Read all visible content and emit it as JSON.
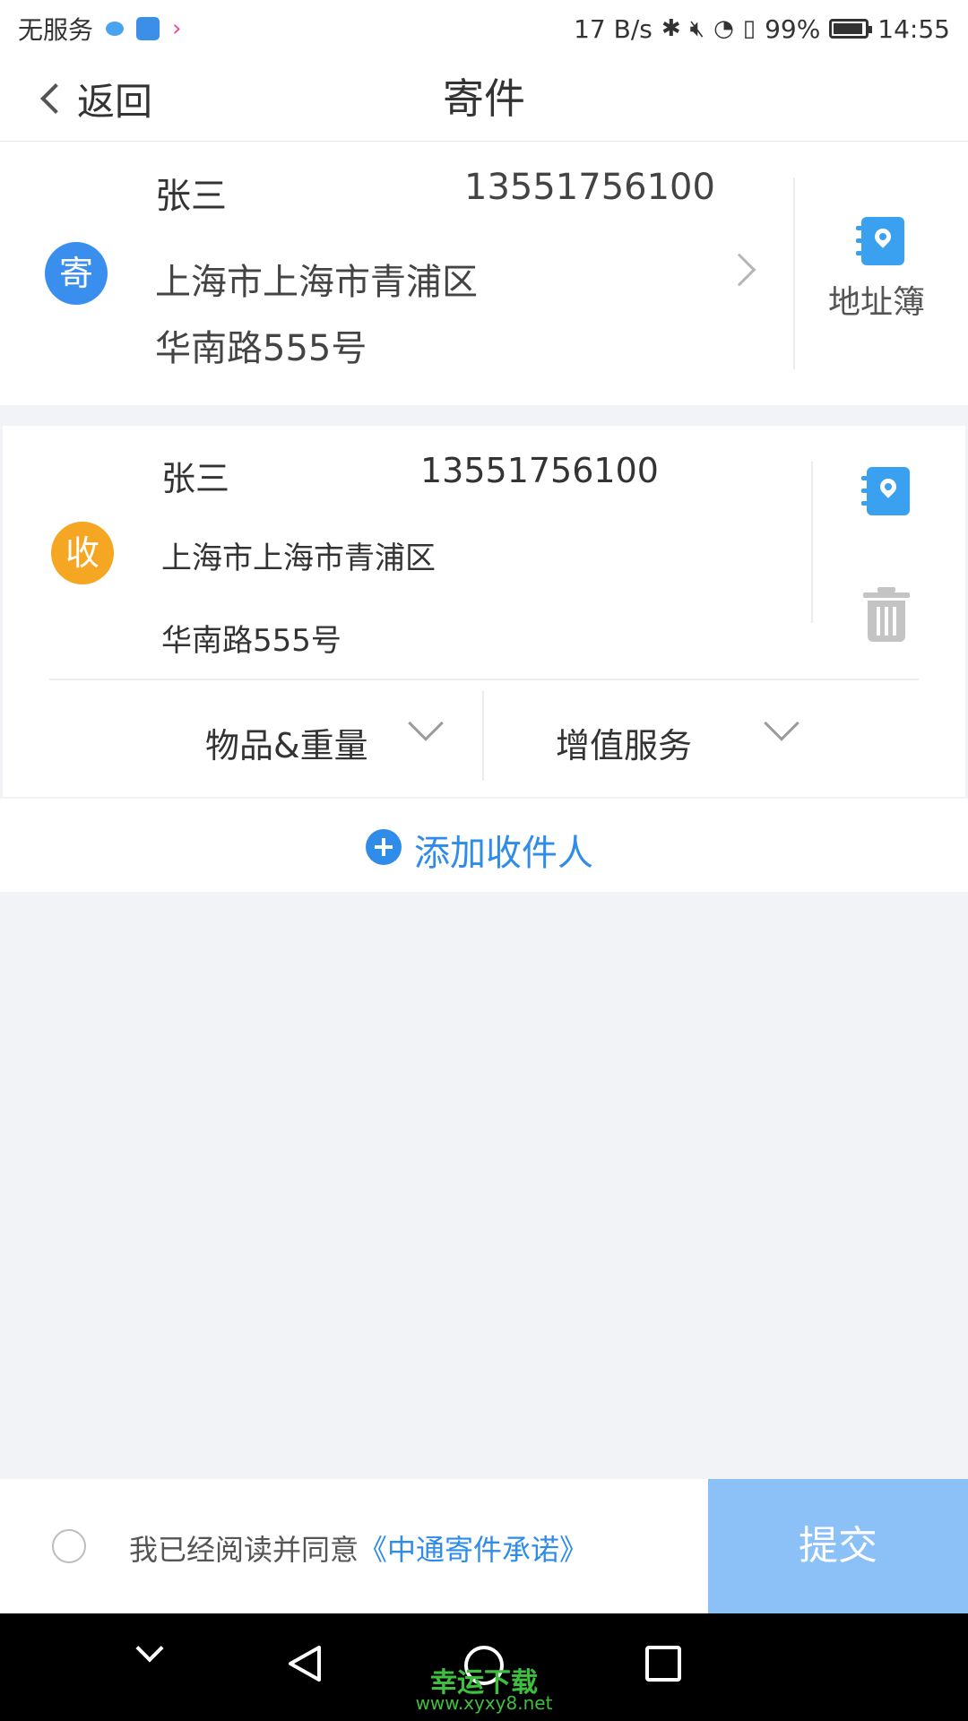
{
  "status_bar": {
    "carrier": "无服务",
    "net_speed": "17 B/s",
    "battery": "99%",
    "time": "14:55",
    "app_icon_color_1": "#49a3f0",
    "app_icon_color_2": "#3c8fe6",
    "app_icon_color_3": "#e64aa0"
  },
  "header": {
    "back_label": "返回",
    "title": "寄件"
  },
  "sender": {
    "badge": "寄",
    "badge_color": "#3a8fee",
    "name": "张三",
    "phone": "13551756100",
    "address_line1": "上海市上海市青浦区",
    "address_line2": "华南路555号",
    "address_book_label": "地址簿"
  },
  "receiver": {
    "badge": "收",
    "badge_color": "#f5a623",
    "name": "张三",
    "phone": "13551756100",
    "address_line1": "上海市上海市青浦区",
    "address_line2": "华南路555号",
    "goods_weight_label": "物品&重量",
    "value_added_label": "增值服务"
  },
  "add_receiver_label": "添加收件人",
  "agreement": {
    "prefix": "我已经阅读并同意",
    "link": "《中通寄件承诺》",
    "checked": false
  },
  "submit_label": "提交",
  "watermark": {
    "title": "幸运下载",
    "url": "www.xyxy8.net"
  },
  "colors": {
    "accent": "#2f8ce8",
    "submit_bg": "#8cc1f8",
    "page_bg": "#f2f3f7"
  }
}
